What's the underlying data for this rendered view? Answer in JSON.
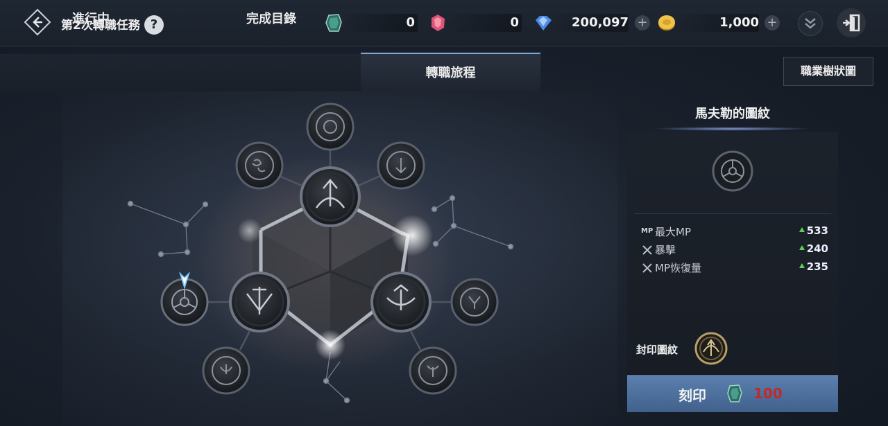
{
  "header": {
    "title": "第2次轉職任務",
    "help_label": "?",
    "currencies": [
      {
        "name": "green-crystal",
        "value": "0",
        "color": "#3fa38c"
      },
      {
        "name": "red-gem",
        "value": "0",
        "color": "#e05575"
      },
      {
        "name": "blue-diamond",
        "value": "200,097",
        "color": "#4c8ce8"
      },
      {
        "name": "gold-coin",
        "value": "1,000",
        "color": "#e7b438"
      }
    ],
    "plus_label": "+"
  },
  "tabs": [
    {
      "label": "進行中",
      "active": false
    },
    {
      "label": "完成目錄",
      "active": false
    },
    {
      "label": "轉職旅程",
      "active": true
    }
  ],
  "class_tree_button": "職業樹狀圖",
  "side": {
    "title": "馬夫勒的圖紋",
    "stats": [
      {
        "icon": "MP",
        "label": "最大MP",
        "value": "533"
      },
      {
        "icon": "swords-icon",
        "label": "暴擊",
        "value": "240"
      },
      {
        "icon": "swords-icon",
        "label": "MP恢復量",
        "value": "235"
      }
    ],
    "seal_label": "封印圖紋",
    "engrave_label": "刻印",
    "engrave_cost": "100"
  }
}
